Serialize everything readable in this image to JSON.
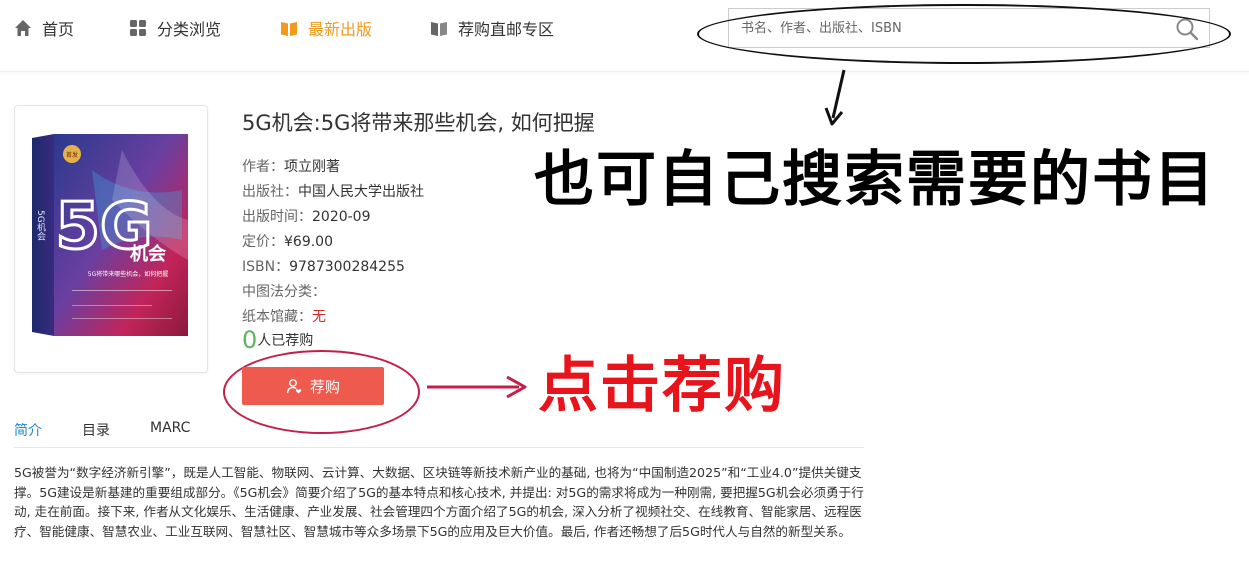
{
  "nav": {
    "items": [
      {
        "label": "首页",
        "icon": "home-icon"
      },
      {
        "label": "分类浏览",
        "icon": "grid-icon"
      },
      {
        "label": "最新出版",
        "icon": "open-book-icon",
        "active": true
      },
      {
        "label": "荐购直邮专区",
        "icon": "book-icon"
      }
    ],
    "active_color": "#f39a1e"
  },
  "search": {
    "placeholder": "书名、作者、出版社、ISBN",
    "value": ""
  },
  "annotations": {
    "search_hint": "也可自己搜索需要的书目",
    "recommend_hint": "点击荐购",
    "hint_color_recommend": "#e8141b"
  },
  "book": {
    "title": "5G机会:5G将带来那些机会, 如何把握",
    "author_label": "作者：",
    "author": "项立刚著",
    "publisher_label": "出版社：",
    "publisher": "中国人民大学出版社",
    "date_label": "出版时间：",
    "date": "2020-09",
    "price_label": "定价：",
    "price": "¥69.00",
    "isbn_label": "ISBN：",
    "isbn": "9787300284255",
    "clc_label": "中图法分类：",
    "clc": "",
    "holding_label": "纸本馆藏：",
    "holding": "无",
    "recommend_count": "0",
    "recommend_suffix": "人已荐购",
    "cover": {
      "big_text": "5G",
      "sub_text": "机会",
      "tagline": "5G将带来哪些机会，如何把握",
      "side_text": "5G机会",
      "stamp": "首发"
    }
  },
  "actions": {
    "recommend_label": "荐购",
    "recommend_color": "#ef5a4f"
  },
  "tabs": [
    {
      "label": "简介",
      "active": true
    },
    {
      "label": "目录"
    },
    {
      "label": "MARC"
    }
  ],
  "description": "5G被誉为“数字经济新引擎”，既是人工智能、物联网、云计算、大数据、区块链等新技术新产业的基础, 也将为“中国制造2025”和“工业4.0”提供关键支撑。5G建设是新基建的重要组成部分。《5G机会》简要介绍了5G的基本特点和核心技术, 并提出: 对5G的需求将成为一种刚需, 要把握5G机会必须勇于行动, 走在前面。接下来, 作者从文化娱乐、生活健康、产业发展、社会管理四个方面介绍了5G的机会, 深入分析了视频社交、在线教育、智能家居、远程医疗、智能健康、智慧农业、工业互联网、智慧社区、智慧城市等众多场景下5G的应用及巨大价值。最后, 作者还畅想了后5G时代人与自然的新型关系。"
}
